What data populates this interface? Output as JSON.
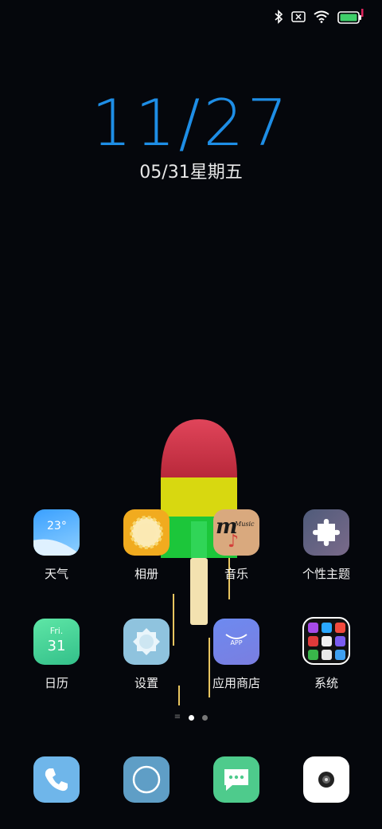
{
  "status_bar": {
    "icons": [
      "bluetooth-icon",
      "no-sim-icon",
      "wifi-icon",
      "battery-icon"
    ],
    "battery_color": "#3fcf6a"
  },
  "lock_clock": {
    "time": "11/27",
    "date": "05/31星期五",
    "color": "#1e8ee6"
  },
  "apps": [
    {
      "label": "天气",
      "icon": "weather-icon",
      "text": "23°"
    },
    {
      "label": "相册",
      "icon": "photos-icon"
    },
    {
      "label": "音乐",
      "icon": "music-icon",
      "text": "Music"
    },
    {
      "label": "个性主题",
      "icon": "theme-puzzle-icon"
    },
    {
      "label": "日历",
      "icon": "calendar-icon",
      "day": "Fri.",
      "date": "31"
    },
    {
      "label": "设置",
      "icon": "settings-icon"
    },
    {
      "label": "应用商店",
      "icon": "app-store-icon",
      "text": "APP"
    },
    {
      "label": "系统",
      "icon": "system-folder-icon"
    }
  ],
  "page_indicator": {
    "current": 2,
    "total": 3
  },
  "dock": [
    {
      "name": "phone",
      "icon": "phone-icon"
    },
    {
      "name": "browser",
      "icon": "browser-icon"
    },
    {
      "name": "messages",
      "icon": "messages-icon"
    },
    {
      "name": "camera",
      "icon": "camera-icon"
    }
  ]
}
